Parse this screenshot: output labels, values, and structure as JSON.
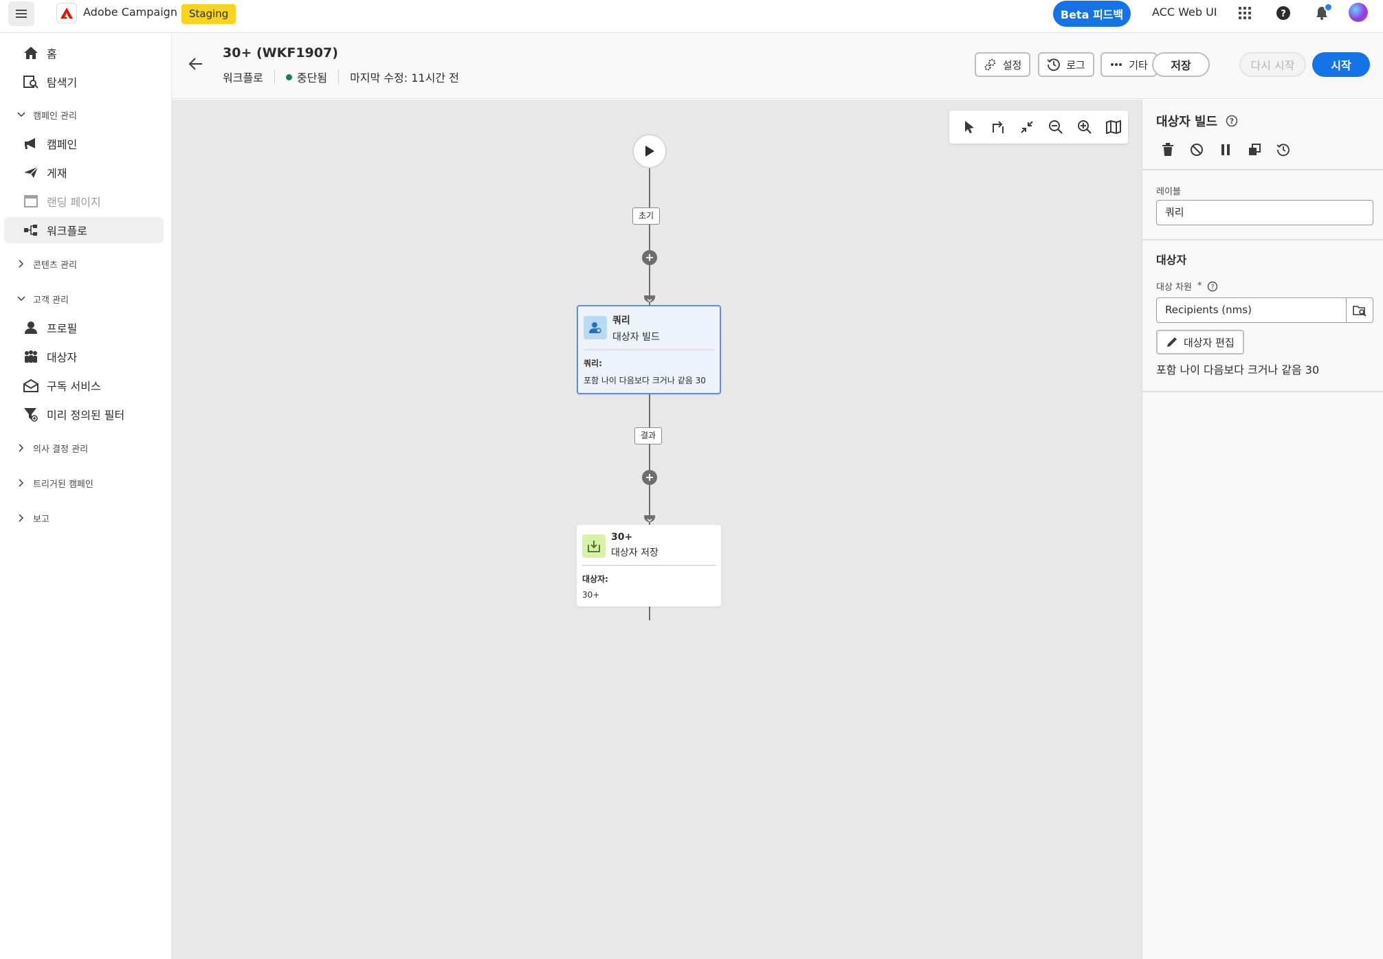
{
  "topbar": {
    "brand": "Adobe Campaign",
    "environment": "Staging",
    "beta_feedback": "Beta 피드백",
    "org": "ACC Web UI"
  },
  "sidebar": {
    "home": "홈",
    "explorer": "탐색기",
    "campaign_management": "캠페인 관리",
    "campaigns": "캠페인",
    "deliveries": "게재",
    "landing_pages": "랜딩 페이지",
    "workflows": "워크플로",
    "content_management": "콘텐츠 관리",
    "customer_management": "고객 관리",
    "profiles": "프로필",
    "audiences": "대상자",
    "subscription_services": "구독 서비스",
    "predefined_filters": "미리 정의된 필터",
    "decision_management": "의사 결정 관리",
    "triggered_campaigns": "트리거된 캠페인",
    "reports": "보고"
  },
  "header": {
    "title": "30+ (WKF1907)",
    "type": "워크플로",
    "status": "중단됨",
    "last_modified": "마지막 수정: 11시간 전",
    "settings": "설정",
    "logs": "로그",
    "more": "기타",
    "save": "저장",
    "restart": "다시 시작",
    "start": "시작"
  },
  "canvas": {
    "transition_initial": "초기",
    "transition_result": "결과",
    "activities": [
      {
        "name": "쿼리",
        "type": "대상자 빌드",
        "detail_label": "쿼리:",
        "detail_value": "포함 나이 다음보다 크거나 같음 30"
      },
      {
        "name": "30+",
        "type": "대상자 저장",
        "detail_label": "대상자:",
        "detail_value": "30+"
      }
    ]
  },
  "panel": {
    "title": "대상자 빌드",
    "label_field_label": "레이블",
    "label_field_value": "쿼리",
    "audience_section": "대상자",
    "targeting_dimension_label": "대상 차원",
    "required_mark": "*",
    "targeting_dimension_value": "Recipients (nms)",
    "edit_audience": "대상자 편집",
    "rule_summary": "포함 나이 다음보다 크거나 같음 30"
  },
  "colors": {
    "accent": "#1473e6",
    "staging": "#f7d51d",
    "status_stopped": "#12805c",
    "selected_border": "#5b8eea"
  }
}
